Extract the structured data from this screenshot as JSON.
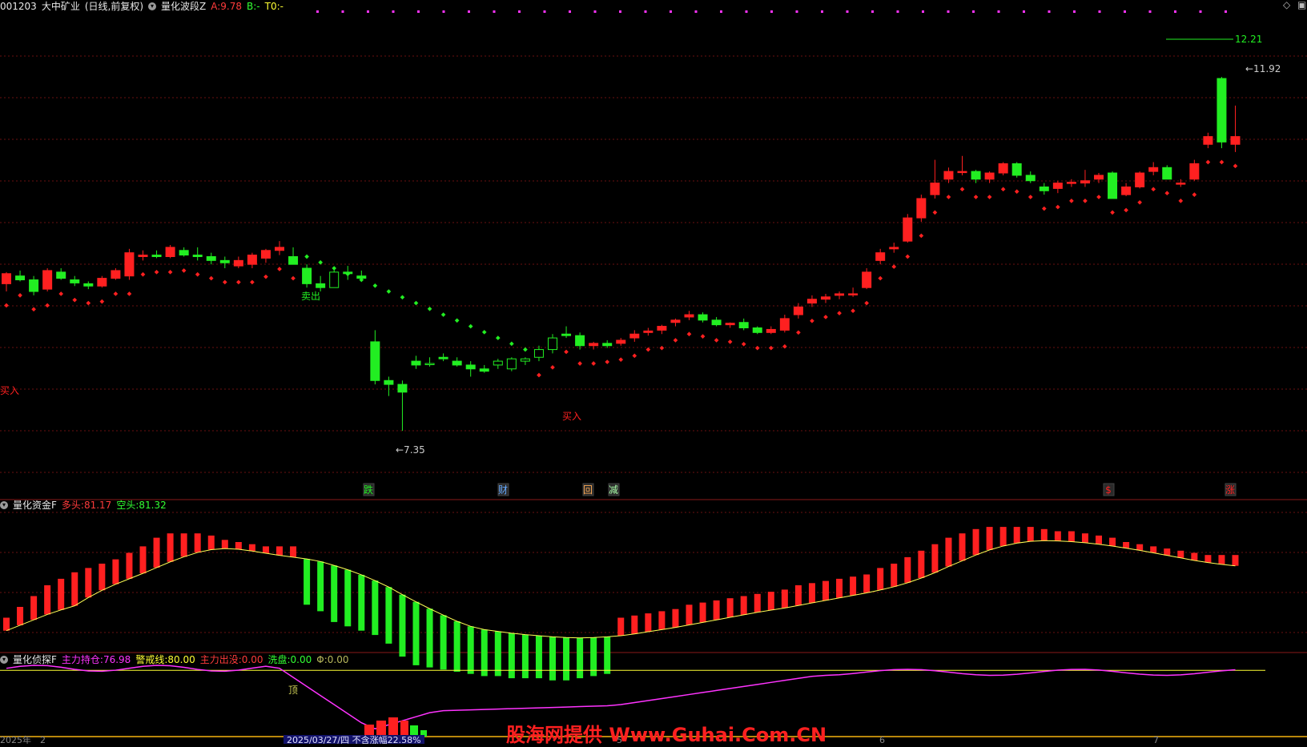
{
  "header": {
    "stock_code": "001203",
    "stock_name": "大中矿业",
    "period": "(日线,前复权)",
    "indicator": "量化波段Z",
    "a_label": "A:",
    "a_value": "9.78",
    "b_label": "B:",
    "b_value": "-",
    "t0_label": "T0:",
    "t0_value": "-"
  },
  "panel2": {
    "name": "量化资金F",
    "long_label": "多头:",
    "long_value": "81.17",
    "short_label": "空头:",
    "short_value": "81.32"
  },
  "panel3": {
    "name": "量化侦探F",
    "hold_label": "主力持仓:",
    "hold_value": "76.98",
    "warn_label": "警戒线:",
    "warn_value": "80.00",
    "out_label": "主力出没:",
    "out_value": "0.00",
    "wash_label": "洗盘:",
    "wash_value": "0.00",
    "extra_label": "Φ:",
    "extra_value": "0.00"
  },
  "annotations": {
    "sell": "卖出",
    "buy": "买入",
    "high_price": "12.21",
    "high_label": "11.92",
    "low_label": "7.35",
    "top": "顶",
    "markers": [
      "跌",
      "财",
      "回",
      "减",
      "$",
      "涨"
    ]
  },
  "bottom_bar": {
    "year": "2025年",
    "digit": "2",
    "date_box": "2025/03/27/四 不含涨幅22.58%",
    "tick1": "5",
    "tick2": "6",
    "tick3": "7"
  },
  "watermark": "股海网提供 Www.Guhai.Com.CN",
  "colors": {
    "background": "#000000",
    "up": "#ff2020",
    "down": "#22ee22",
    "grid": "#6a1010",
    "purple": "#ff33ff",
    "yellow": "#ffff33"
  },
  "chart_data": [
    {
      "type": "candlestick",
      "title": "量化波段Z",
      "ylim": [
        7.0,
        12.5
      ],
      "price_labels": [
        12.21,
        11.92,
        7.35
      ],
      "candles": [
        [
          9.25,
          9.4,
          9.15,
          9.38
        ],
        [
          9.35,
          9.42,
          9.28,
          9.3
        ],
        [
          9.3,
          9.35,
          9.1,
          9.15
        ],
        [
          9.18,
          9.45,
          9.15,
          9.42
        ],
        [
          9.4,
          9.45,
          9.3,
          9.32
        ],
        [
          9.3,
          9.35,
          9.22,
          9.26
        ],
        [
          9.25,
          9.28,
          9.18,
          9.22
        ],
        [
          9.22,
          9.35,
          9.2,
          9.32
        ],
        [
          9.32,
          9.45,
          9.3,
          9.42
        ],
        [
          9.35,
          9.7,
          9.3,
          9.65
        ],
        [
          9.6,
          9.68,
          9.55,
          9.62
        ],
        [
          9.62,
          9.68,
          9.58,
          9.6
        ],
        [
          9.6,
          9.75,
          9.58,
          9.72
        ],
        [
          9.68,
          9.72,
          9.6,
          9.62
        ],
        [
          9.62,
          9.72,
          9.55,
          9.6
        ],
        [
          9.6,
          9.65,
          9.5,
          9.55
        ],
        [
          9.55,
          9.6,
          9.45,
          9.52
        ],
        [
          9.48,
          9.6,
          9.45,
          9.55
        ],
        [
          9.5,
          9.65,
          9.45,
          9.62
        ],
        [
          9.58,
          9.7,
          9.52,
          9.68
        ],
        [
          9.68,
          9.8,
          9.62,
          9.72
        ],
        [
          9.6,
          9.72,
          9.55,
          9.5
        ],
        [
          9.45,
          9.5,
          9.2,
          9.25
        ],
        [
          9.25,
          9.35,
          9.15,
          9.2
        ],
        [
          9.2,
          9.45,
          9.2,
          9.4
        ],
        [
          9.4,
          9.48,
          9.3,
          9.38
        ],
        [
          9.35,
          9.42,
          9.3,
          9.32
        ],
        [
          8.5,
          8.65,
          7.95,
          8.0
        ],
        [
          8.0,
          8.05,
          7.8,
          7.95
        ],
        [
          7.95,
          8.0,
          7.35,
          7.85
        ],
        [
          8.25,
          8.32,
          8.15,
          8.2
        ],
        [
          8.22,
          8.3,
          8.18,
          8.22
        ],
        [
          8.3,
          8.35,
          8.25,
          8.28
        ],
        [
          8.25,
          8.3,
          8.18,
          8.2
        ],
        [
          8.2,
          8.25,
          8.05,
          8.15
        ],
        [
          8.15,
          8.2,
          8.1,
          8.12
        ],
        [
          8.2,
          8.28,
          8.15,
          8.25
        ],
        [
          8.15,
          8.3,
          8.12,
          8.28
        ],
        [
          8.25,
          8.3,
          8.2,
          8.28
        ],
        [
          8.3,
          8.45,
          8.25,
          8.4
        ],
        [
          8.4,
          8.6,
          8.35,
          8.55
        ],
        [
          8.6,
          8.7,
          8.55,
          8.58
        ],
        [
          8.58,
          8.62,
          8.4,
          8.45
        ],
        [
          8.45,
          8.5,
          8.4,
          8.48
        ],
        [
          8.48,
          8.52,
          8.42,
          8.45
        ],
        [
          8.48,
          8.55,
          8.45,
          8.52
        ],
        [
          8.55,
          8.65,
          8.5,
          8.6
        ],
        [
          8.62,
          8.68,
          8.58,
          8.64
        ],
        [
          8.65,
          8.72,
          8.6,
          8.7
        ],
        [
          8.75,
          8.8,
          8.7,
          8.78
        ],
        [
          8.82,
          8.9,
          8.78,
          8.85
        ],
        [
          8.85,
          8.88,
          8.75,
          8.78
        ],
        [
          8.78,
          8.82,
          8.7,
          8.72
        ],
        [
          8.72,
          8.75,
          8.68,
          8.74
        ],
        [
          8.75,
          8.8,
          8.65,
          8.68
        ],
        [
          8.68,
          8.7,
          8.6,
          8.62
        ],
        [
          8.62,
          8.7,
          8.6,
          8.66
        ],
        [
          8.65,
          8.85,
          8.62,
          8.8
        ],
        [
          8.85,
          9.0,
          8.8,
          8.95
        ],
        [
          9.0,
          9.1,
          8.95,
          9.05
        ],
        [
          9.05,
          9.12,
          9.0,
          9.08
        ],
        [
          9.1,
          9.15,
          9.05,
          9.12
        ],
        [
          9.12,
          9.2,
          9.08,
          9.12
        ],
        [
          9.2,
          9.45,
          9.18,
          9.4
        ],
        [
          9.55,
          9.7,
          9.5,
          9.65
        ],
        [
          9.7,
          9.78,
          9.65,
          9.72
        ],
        [
          9.8,
          10.15,
          9.78,
          10.1
        ],
        [
          10.1,
          10.4,
          10.05,
          10.35
        ],
        [
          10.4,
          10.85,
          10.35,
          10.55
        ],
        [
          10.6,
          10.75,
          10.55,
          10.7
        ],
        [
          10.7,
          10.9,
          10.65,
          10.7
        ],
        [
          10.7,
          10.72,
          10.55,
          10.6
        ],
        [
          10.6,
          10.7,
          10.55,
          10.68
        ],
        [
          10.68,
          10.82,
          10.65,
          10.8
        ],
        [
          10.8,
          10.82,
          10.62,
          10.65
        ],
        [
          10.65,
          10.7,
          10.55,
          10.58
        ],
        [
          10.5,
          10.55,
          10.4,
          10.45
        ],
        [
          10.48,
          10.58,
          10.42,
          10.55
        ],
        [
          10.55,
          10.6,
          10.5,
          10.56
        ],
        [
          10.55,
          10.72,
          10.5,
          10.58
        ],
        [
          10.6,
          10.68,
          10.55,
          10.65
        ],
        [
          10.68,
          10.7,
          10.35,
          10.35
        ],
        [
          10.4,
          10.55,
          10.38,
          10.5
        ],
        [
          10.5,
          10.7,
          10.48,
          10.68
        ],
        [
          10.7,
          10.82,
          10.65,
          10.75
        ],
        [
          10.75,
          10.78,
          10.6,
          10.6
        ],
        [
          10.55,
          10.6,
          10.5,
          10.55
        ],
        [
          10.6,
          10.85,
          10.58,
          10.8
        ],
        [
          11.05,
          11.2,
          11.0,
          11.15
        ],
        [
          11.9,
          11.92,
          11.0,
          11.08
        ],
        [
          11.05,
          11.55,
          10.95,
          11.15
        ]
      ],
      "signals": {
        "sell": "卖出",
        "buy": "买入"
      }
    },
    {
      "type": "bar",
      "title": "量化资金F",
      "series": [
        {
          "name": "多头",
          "last": 81.17
        },
        {
          "name": "空头",
          "last": 81.32
        }
      ],
      "values": [
        55,
        60,
        65,
        70,
        73,
        76,
        78,
        80,
        82,
        85,
        88,
        92,
        94,
        94,
        94,
        93,
        91,
        90,
        89,
        88,
        88,
        88,
        86,
        83,
        78,
        76,
        74,
        72,
        68,
        62,
        58,
        57,
        56,
        55,
        54,
        53,
        53,
        52,
        52,
        52,
        51,
        51,
        52,
        53,
        54,
        55,
        56,
        57,
        58,
        59,
        61,
        62,
        63,
        64,
        65,
        66,
        67,
        68,
        70,
        71,
        72,
        73,
        74,
        75,
        78,
        80,
        83,
        86,
        89,
        92,
        94,
        96,
        97,
        97,
        97,
        97,
        96,
        95,
        95,
        94,
        93,
        92,
        90,
        89,
        88,
        87,
        86,
        85,
        84,
        84,
        84
      ]
    },
    {
      "type": "line",
      "title": "量化侦探F",
      "series": [
        {
          "name": "主力持仓",
          "last": 76.98
        },
        {
          "name": "警戒线",
          "value": 80.0
        }
      ],
      "ylim": [
        0,
        100
      ]
    }
  ]
}
